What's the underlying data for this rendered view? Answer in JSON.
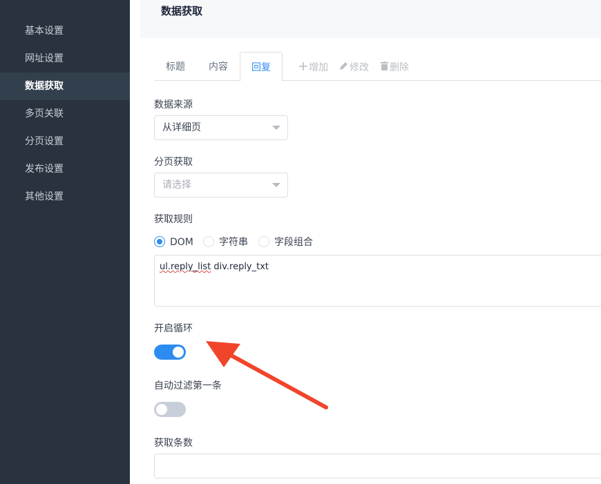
{
  "sidebar": {
    "items": [
      {
        "label": "基本设置"
      },
      {
        "label": "网址设置"
      },
      {
        "label": "数据获取"
      },
      {
        "label": "多页关联"
      },
      {
        "label": "分页设置"
      },
      {
        "label": "发布设置"
      },
      {
        "label": "其他设置"
      }
    ],
    "active_index": 2
  },
  "header": {
    "title": "数据获取"
  },
  "tabs": {
    "items": [
      {
        "label": "标题"
      },
      {
        "label": "内容"
      },
      {
        "label": "回复"
      }
    ],
    "active_index": 2,
    "actions": [
      {
        "label": "增加",
        "icon": "plus-icon"
      },
      {
        "label": "修改",
        "icon": "pencil-icon"
      },
      {
        "label": "删除",
        "icon": "trash-icon"
      }
    ]
  },
  "form": {
    "data_source": {
      "label": "数据来源",
      "value": "从详细页"
    },
    "page_fetch": {
      "label": "分页获取",
      "placeholder": "请选择"
    },
    "rule": {
      "label": "获取规则",
      "options": [
        {
          "label": "DOM"
        },
        {
          "label": "字符串"
        },
        {
          "label": "字段组合"
        }
      ],
      "selected_index": 0,
      "value_part1": "ul.reply_list",
      "value_part2": " div.reply_txt"
    },
    "loop": {
      "label": "开启循环",
      "on": true
    },
    "filter_first": {
      "label": "自动过滤第一条",
      "on": false
    },
    "count": {
      "label": "获取条数",
      "value": ""
    }
  },
  "colors": {
    "sidebar_bg": "#29333f",
    "accent": "#2d8cf0",
    "annotation_arrow": "#f0452b"
  }
}
